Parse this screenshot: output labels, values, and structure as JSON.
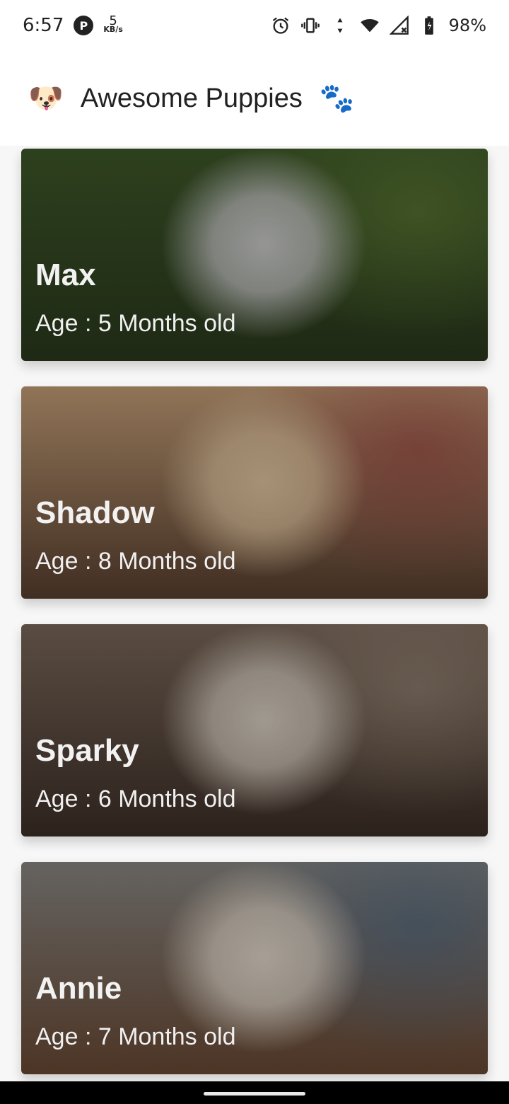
{
  "status_bar": {
    "time": "6:57",
    "speed_value": "5",
    "speed_unit": "KB/s",
    "battery": "98%",
    "icons": [
      "p-circle-icon",
      "alarm-icon",
      "vibrate-icon",
      "data-arrows-icon",
      "wifi-icon",
      "cell-signal-icon",
      "battery-icon"
    ]
  },
  "app_bar": {
    "leading_emoji": "🐶",
    "title": "Awesome Puppies",
    "trailing_emoji": "🐾"
  },
  "puppies": [
    {
      "name": "Max",
      "age": "Age : 5 Months old",
      "colors": [
        "#3f5a2a",
        "#2b3a1d",
        "#cfcfcf",
        "#6a8a3a"
      ]
    },
    {
      "name": "Shadow",
      "age": "Age : 8 Months old",
      "colors": [
        "#c9a27a",
        "#5a4030",
        "#e6c9a3",
        "#a04040"
      ]
    },
    {
      "name": "Sparky",
      "age": "Age : 6 Months old",
      "colors": [
        "#7d6a5c",
        "#3e3028",
        "#ded4c8",
        "#a89684"
      ]
    },
    {
      "name": "Annie",
      "age": "Age : 7 Months old",
      "colors": [
        "#8c8a86",
        "#6b4a34",
        "#e8ddd0",
        "#4a6a8a"
      ]
    }
  ]
}
